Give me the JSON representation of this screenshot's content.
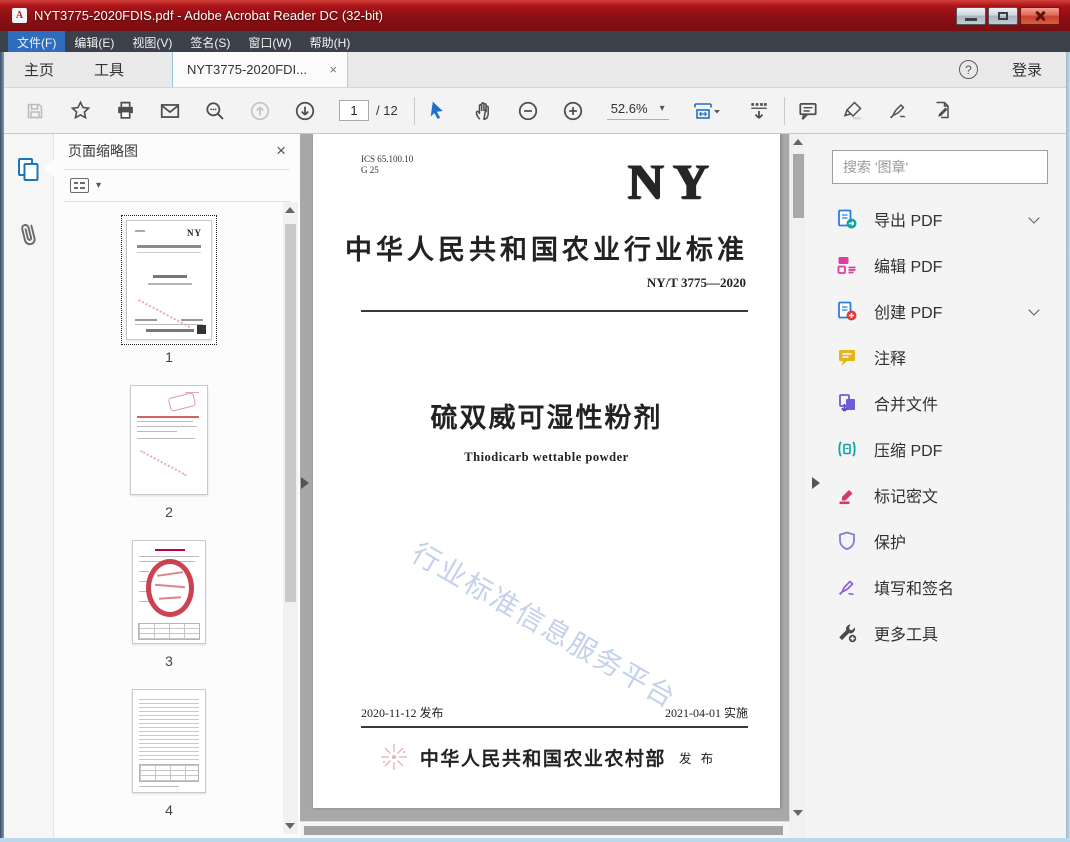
{
  "window": {
    "title": "NYT3775-2020FDIS.pdf - Adobe Acrobat Reader DC (32-bit)",
    "pdf_badge": "A"
  },
  "menu": {
    "items": [
      {
        "label": "文件(F)"
      },
      {
        "label": "编辑(E)"
      },
      {
        "label": "视图(V)"
      },
      {
        "label": "签名(S)"
      },
      {
        "label": "窗口(W)"
      },
      {
        "label": "帮助(H)"
      }
    ]
  },
  "tabbar": {
    "home": "主页",
    "tools": "工具",
    "document_tab": "NYT3775-2020FDI...",
    "close_glyph": "×",
    "help_glyph": "?",
    "login": "登录"
  },
  "toolbar": {
    "page_current": "1",
    "page_total_label": "/ 12",
    "zoom_value": "52.6%",
    "caret_glyph": "▾"
  },
  "thumbnails_panel": {
    "title": "页面缩略图",
    "close_glyph": "×",
    "options_caret": "▾",
    "pages": [
      {
        "number": "1"
      },
      {
        "number": "2"
      },
      {
        "number": "3"
      },
      {
        "number": "4"
      }
    ]
  },
  "document": {
    "ics_code": "ICS 65.100.10",
    "doc_class": "G 25",
    "logo": "NY",
    "standard_category": "中华人民共和国农业行业标准",
    "standard_number": "NY/T 3775—2020",
    "title_cn": "硫双威可湿性粉剂",
    "title_en": "Thiodicarb wettable powder",
    "watermark": "行业标准信息服务平台",
    "release_date": "2020-11-12 发布",
    "implement_date": "2021-04-01 实施",
    "issuer": "中华人民共和国农业农村部",
    "issue_label": "发 布"
  },
  "tools_panel": {
    "search_placeholder": "搜索 '图章'",
    "items": [
      {
        "label": "导出 PDF",
        "expandable": true
      },
      {
        "label": "编辑 PDF",
        "expandable": false
      },
      {
        "label": "创建 PDF",
        "expandable": true
      },
      {
        "label": "注释",
        "expandable": false
      },
      {
        "label": "合并文件",
        "expandable": false
      },
      {
        "label": "压缩 PDF",
        "expandable": false
      },
      {
        "label": "标记密文",
        "expandable": false
      },
      {
        "label": "保护",
        "expandable": false
      },
      {
        "label": "填写和签名",
        "expandable": false
      },
      {
        "label": "更多工具",
        "expandable": false
      }
    ]
  },
  "colors": {
    "titlebar_red": "#8d1014",
    "menubar": "#3c404b",
    "accent_blue": "#1e71c9",
    "doc_background": "#a8a8a8",
    "watermark_blue": "#94acd8",
    "stamp_red": "#c62d3e"
  }
}
